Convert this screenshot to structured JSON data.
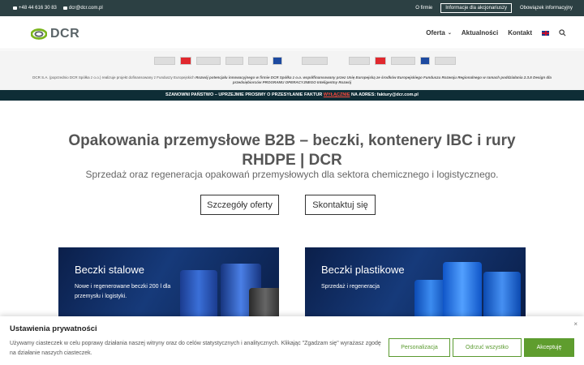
{
  "topbar": {
    "phone": "+48 44 616 30 83",
    "email": "dcr@dcr.com.pl",
    "links": [
      "O firmie",
      "Informacje dla akcjonariuszy",
      "Obowiązek informacyjny"
    ]
  },
  "header": {
    "logo_text": "DCR",
    "nav": [
      "Oferta",
      "Aktualności",
      "Kontakt"
    ]
  },
  "funding": {
    "text_plain": "DCR S.A. (poprzednio DCR Spółka z o.o.) realizuje projekt dofinansowany z Funduszy Europejskich ",
    "text_bold": "Rozwój potencjału innowacyjnego w firmie DCR Spółka z o.o. współfinansowany przez Unię Europejską ze środków Europejskiego Funduszu Rozwoju Regionalnego w ramach poddziałania 2.3.5 Design dla przedsiębiorców PROGRAMU OPERACYJNEGO Inteligentny Rozwój"
  },
  "notice": {
    "before": "SZANOWNI PAŃSTWO – UPRZEJMIE PROSIMY O PRZESYŁANIE FAKTUR",
    "warn": "WYŁĄCZNIE",
    "after": "NA ADRES:",
    "address": "faktury@dcr.com.pl"
  },
  "hero": {
    "title": "Opakowania przemysłowe B2B – beczki, kontenery IBC i rury RHDPE | DCR",
    "subtitle": "Sprzedaż oraz regeneracja opakowań przemysłowych dla sektora chemicznego i logistycznego.",
    "btn_offer": "Szczegóły oferty",
    "btn_contact": "Skontaktuj się"
  },
  "cards": [
    {
      "title": "Beczki stalowe",
      "text": "Nowe i regenerowane beczki 200 l dla przemysłu i logistyki."
    },
    {
      "title": "Beczki plastikowe",
      "text": "Sprzedaż i regeneracja"
    }
  ],
  "cookie": {
    "title": "Ustawienia prywatności",
    "text": "Używamy ciasteczek w celu poprawy działania naszej witryny oraz do celów statystycznych i analitycznych. Klikając \"Zgadzam się\" wyrażasz zgodę na działanie naszych ciasteczek.",
    "btn_custom": "Personalizacja",
    "btn_reject": "Odrzuć wszystko",
    "btn_accept": "Akceptuję",
    "close": "×"
  },
  "colors": {
    "accent_green": "#5f9d2e",
    "topbar": "#2c4043",
    "notice_bg": "#0e2d36",
    "warn": "#ff4a3d"
  }
}
